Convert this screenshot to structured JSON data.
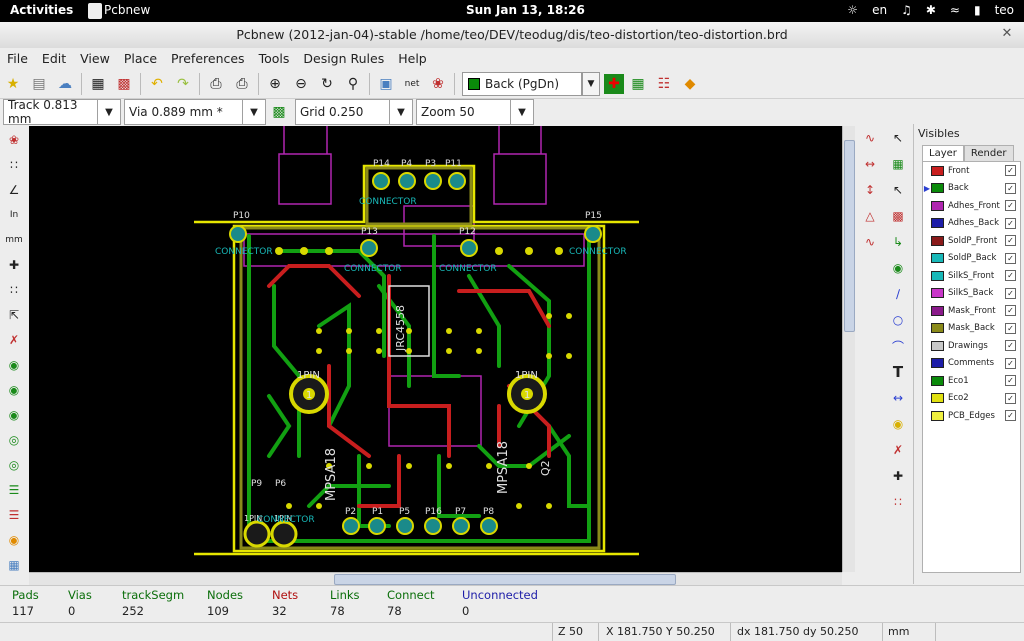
{
  "topbar": {
    "activities": "Activities",
    "app_name": "Pcbnew",
    "clock": "Sun Jan 13, 18:26",
    "language": "en",
    "user": "teo"
  },
  "window": {
    "title": "Pcbnew (2012-jan-04)-stable /home/teo/DEV/teodug/dis/teo-distortion/teo-distortion.brd"
  },
  "menu": [
    "File",
    "Edit",
    "View",
    "Place",
    "Preferences",
    "Tools",
    "Design Rules",
    "Help"
  ],
  "layer_select": {
    "value": "Back (PgDn)",
    "color": "#0a8a0a"
  },
  "toolbar2": {
    "track": "Track 0.813 mm",
    "via": "Via 0.889 mm *",
    "grid": "Grid 0.250",
    "zoom": "Zoom 50"
  },
  "visibles": {
    "title": "Visibles",
    "tabs": [
      "Layer",
      "Render"
    ],
    "layers": [
      {
        "name": "Front",
        "color": "#c81e1e",
        "checked": true
      },
      {
        "name": "Back",
        "color": "#0a8a0a",
        "checked": true
      },
      {
        "name": "Adhes_Front",
        "color": "#b026b0",
        "checked": true
      },
      {
        "name": "Adhes_Back",
        "color": "#1d1da8",
        "checked": true
      },
      {
        "name": "SoldP_Front",
        "color": "#8a1a1a",
        "checked": true
      },
      {
        "name": "SoldP_Back",
        "color": "#18b8b8",
        "checked": true
      },
      {
        "name": "SilkS_Front",
        "color": "#18b8b8",
        "checked": true
      },
      {
        "name": "SilkS_Back",
        "color": "#c836c8",
        "checked": true
      },
      {
        "name": "Mask_Front",
        "color": "#8a1a8a",
        "checked": true
      },
      {
        "name": "Mask_Back",
        "color": "#8a8a1a",
        "checked": true
      },
      {
        "name": "Drawings",
        "color": "#c8c8c8",
        "checked": true
      },
      {
        "name": "Comments",
        "color": "#1d1da8",
        "checked": true
      },
      {
        "name": "Eco1",
        "color": "#0a8a0a",
        "checked": true
      },
      {
        "name": "Eco2",
        "color": "#e0e010",
        "checked": true
      },
      {
        "name": "PCB_Edges",
        "color": "#f0f040",
        "checked": true
      }
    ]
  },
  "stats": [
    {
      "label": "Pads",
      "value": "117",
      "color": "#0a6e0a"
    },
    {
      "label": "Vias",
      "value": "0",
      "color": "#0a6e0a"
    },
    {
      "label": "trackSegm",
      "value": "252",
      "color": "#0a6e0a"
    },
    {
      "label": "Nodes",
      "value": "109",
      "color": "#0a6e0a"
    },
    {
      "label": "Nets",
      "value": "32",
      "color": "#b01010"
    },
    {
      "label": "Links",
      "value": "78",
      "color": "#0a6e0a"
    },
    {
      "label": "Connect",
      "value": "78",
      "color": "#0a6e0a"
    },
    {
      "label": "Unconnected",
      "value": "0",
      "color": "#1d1da8"
    }
  ],
  "statusbar": {
    "zoom": "Z 50",
    "xy": "X 181.750  Y 50.250",
    "dxy": "dx 181.750  dy 50.250",
    "units": "mm"
  },
  "pcb_labels": {
    "p14": "P14",
    "p4": "P4",
    "p3": "P3",
    "p11": "P11",
    "p10": "P10",
    "p15": "P15",
    "p13": "P13",
    "p12": "P12",
    "p9": "P9",
    "p6": "P6",
    "p2": "P2",
    "p1": "P1",
    "p5": "P5",
    "p16": "P16",
    "p7": "P7",
    "p8": "P8",
    "connector": "CONNECTOR",
    "onepin": "1PIN",
    "pad1": "1",
    "ic": "JRC4558",
    "mpsa18": "MPSA18",
    "q2": "Q2"
  }
}
